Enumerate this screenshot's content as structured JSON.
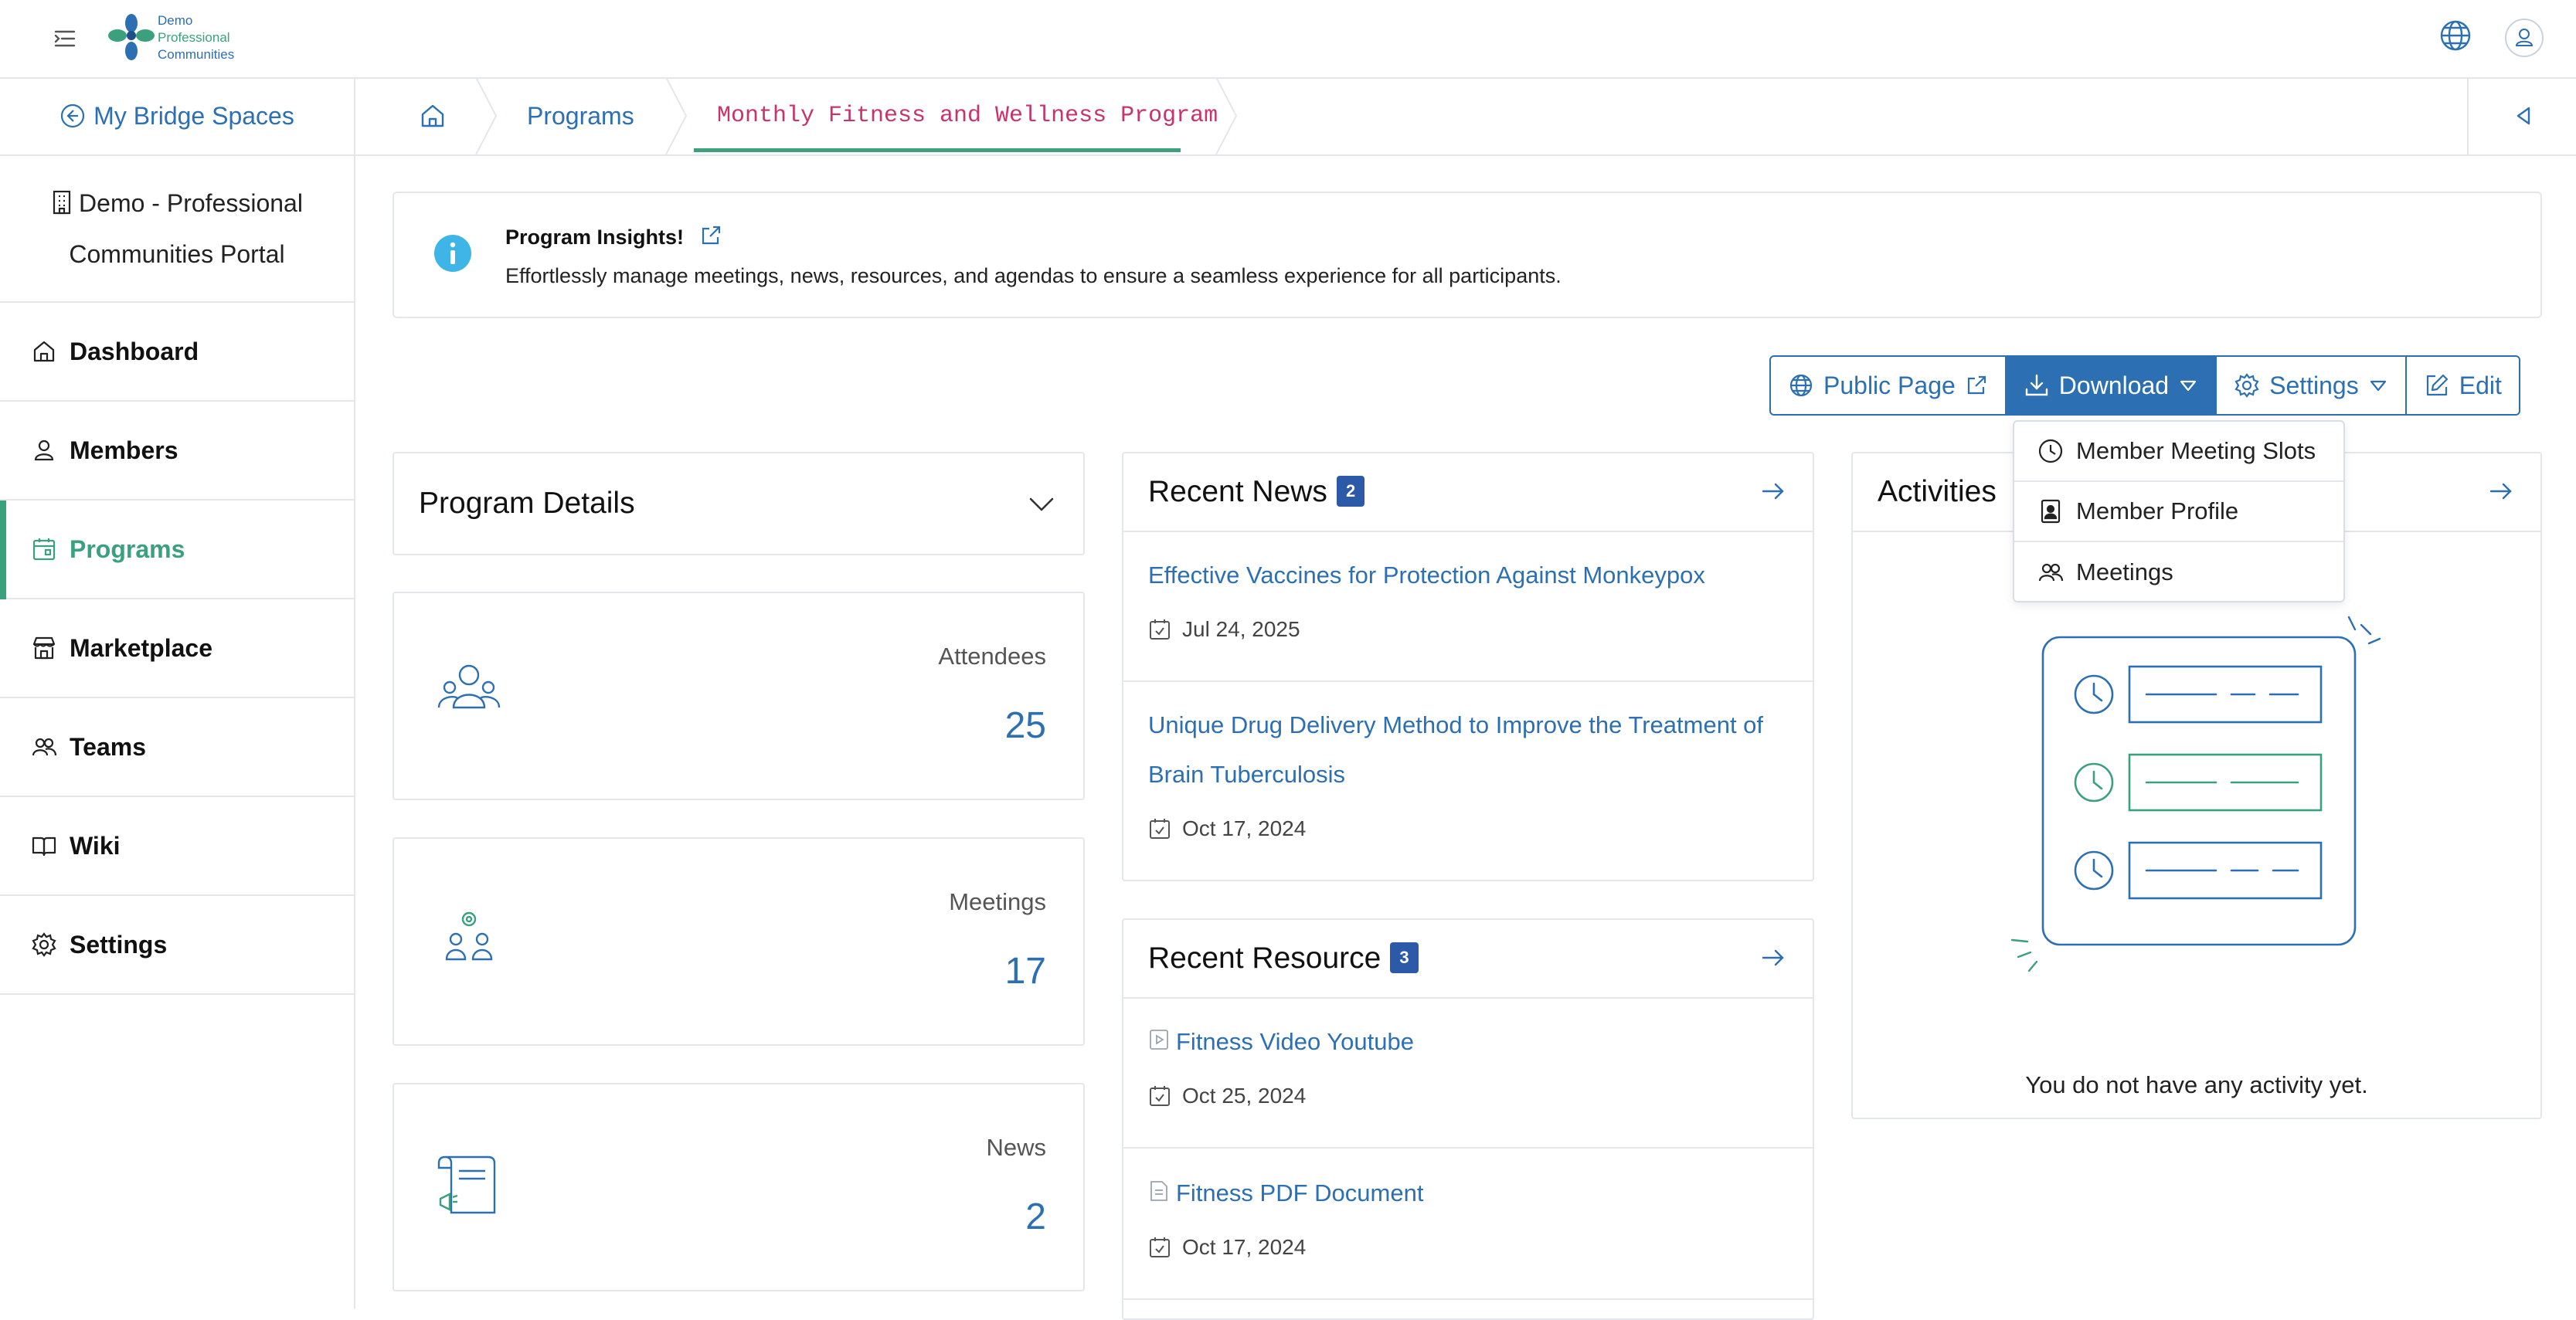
{
  "header": {
    "logo_line1": "Demo",
    "logo_line2": "Professional",
    "logo_line3": "Communities"
  },
  "sidebar": {
    "back_label": "My Bridge Spaces",
    "portal_line1": "Demo - Professional",
    "portal_line2": "Communities Portal",
    "items": [
      {
        "label": "Dashboard",
        "icon": "home-icon"
      },
      {
        "label": "Members",
        "icon": "user-icon"
      },
      {
        "label": "Programs",
        "icon": "calendar-icon",
        "active": true
      },
      {
        "label": "Marketplace",
        "icon": "store-icon"
      },
      {
        "label": "Teams",
        "icon": "users-icon"
      },
      {
        "label": "Wiki",
        "icon": "book-icon"
      },
      {
        "label": "Settings",
        "icon": "gear-icon"
      }
    ]
  },
  "breadcrumb": {
    "programs": "Programs",
    "current": "Monthly Fitness and Wellness Program"
  },
  "insight": {
    "title": "Program Insights!",
    "text": "Effortlessly manage meetings, news, resources, and agendas to ensure a seamless experience for all participants."
  },
  "toolbar": {
    "public_page": "Public Page",
    "download": "Download",
    "settings": "Settings",
    "edit": "Edit"
  },
  "download_menu": {
    "items": [
      "Member Meeting Slots",
      "Member Profile",
      "Meetings"
    ]
  },
  "program_details": {
    "title": "Program Details"
  },
  "stats": [
    {
      "label": "Attendees",
      "value": "25"
    },
    {
      "label": "Meetings",
      "value": "17"
    },
    {
      "label": "News",
      "value": "2"
    }
  ],
  "recent_news": {
    "title": "Recent News",
    "count": "2",
    "items": [
      {
        "title": "Effective Vaccines for Protection Against Monkeypox",
        "date": "Jul 24, 2025"
      },
      {
        "title_line1": "Unique Drug Delivery Method to Improve the Treatment of",
        "title_line2": "Brain Tuberculosis",
        "date": "Oct 17, 2024"
      }
    ]
  },
  "recent_resource": {
    "title": "Recent Resource",
    "count": "3",
    "items": [
      {
        "title": "Fitness Video Youtube",
        "date": "Oct 25, 2024"
      },
      {
        "title": "Fitness PDF Document",
        "date": "Oct 17, 2024"
      }
    ]
  },
  "activities": {
    "title": "Activities",
    "empty_text": "You do not have any activity yet."
  },
  "colors": {
    "primary": "#2c6fb3",
    "accent": "#3aa17c",
    "breadcrumb_current": "#c7336c",
    "badge": "#2c5aa8"
  }
}
